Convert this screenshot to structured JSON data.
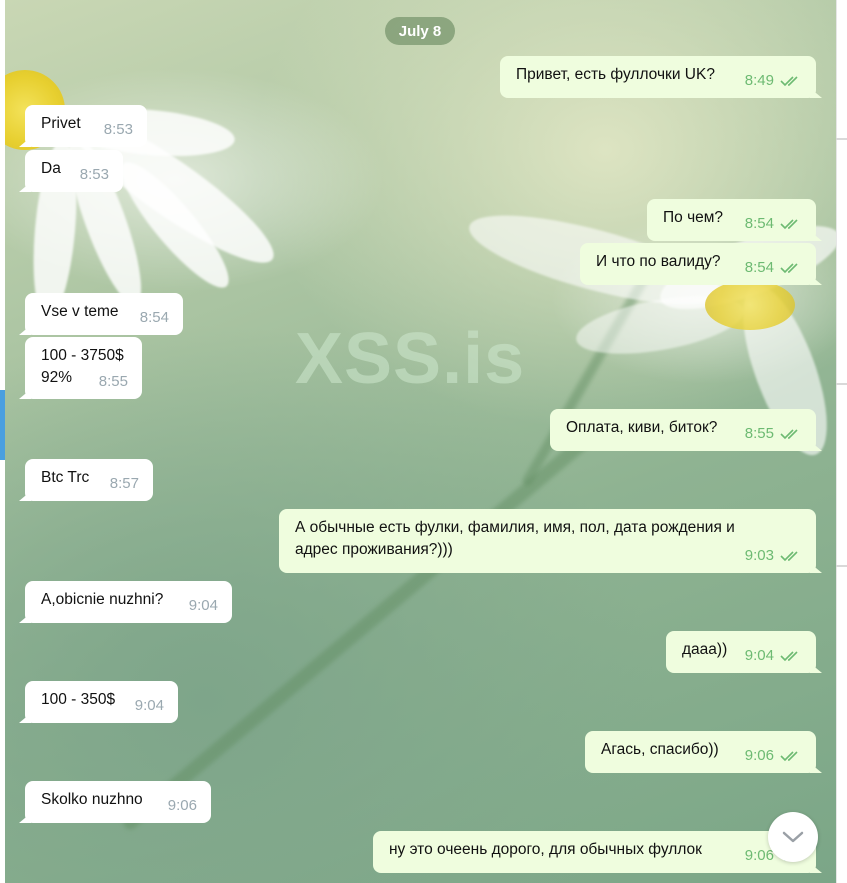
{
  "date_badge": "July 8",
  "watermark": "XSS.is",
  "messages": [
    {
      "dir": "out",
      "text": "Привет, есть фуллочки UK?",
      "time": "8:49"
    },
    {
      "dir": "in",
      "text": "Privet",
      "time": "8:53"
    },
    {
      "dir": "in",
      "text": "Da",
      "time": "8:53"
    },
    {
      "dir": "out",
      "text": "По чем?",
      "time": "8:54"
    },
    {
      "dir": "out",
      "text": "И что по валиду?",
      "time": "8:54"
    },
    {
      "dir": "in",
      "text": "Vse v teme",
      "time": "8:54"
    },
    {
      "dir": "in",
      "text": "100 - 3750$\n92%",
      "time": "8:55"
    },
    {
      "dir": "out",
      "text": "Оплата, киви, биток?",
      "time": "8:55"
    },
    {
      "dir": "in",
      "text": "Btc Trc",
      "time": "8:57"
    },
    {
      "dir": "out",
      "text": "А обычные есть фулки, фамилия, имя, пол, дата рождения и\nадрес проживания?)))",
      "time": "9:03"
    },
    {
      "dir": "in",
      "text": "A,obicnie nuzhni?",
      "time": "9:04"
    },
    {
      "dir": "out",
      "text": "дааа))",
      "time": "9:04"
    },
    {
      "dir": "in",
      "text": "100 - 350$",
      "time": "9:04"
    },
    {
      "dir": "out",
      "text": "Агась, спасибо))",
      "time": "9:06"
    },
    {
      "dir": "in",
      "text": "Skolko nuzhno",
      "time": "9:06"
    },
    {
      "dir": "out",
      "text": "ну это очеень дорого, для обычных фуллок",
      "time": "9:06"
    }
  ],
  "scroll_button_icon": "chevron-down-icon",
  "colors": {
    "incoming_bubble": "#ffffff",
    "outgoing_bubble": "#effdde",
    "outgoing_time": "#6dba72",
    "incoming_time": "#9aa8b0",
    "date_badge": "#7f9a72"
  }
}
